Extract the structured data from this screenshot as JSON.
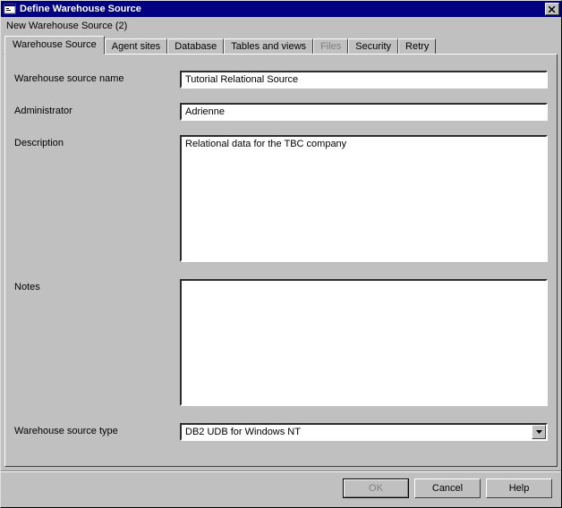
{
  "window": {
    "title": "Define Warehouse Source",
    "subtitle": "New Warehouse Source (2)"
  },
  "tabs": {
    "warehouse_source": "Warehouse Source",
    "agent_sites": "Agent sites",
    "database": "Database",
    "tables_and_views": "Tables and views",
    "files": "Files",
    "security": "Security",
    "retry": "Retry",
    "active": "warehouse_source",
    "disabled": [
      "files"
    ]
  },
  "labels": {
    "source_name": "Warehouse source name",
    "administrator": "Administrator",
    "description": "Description",
    "notes": "Notes",
    "source_type": "Warehouse source type"
  },
  "fields": {
    "source_name": "Tutorial Relational Source",
    "administrator": "Adrienne",
    "description": "Relational data for the TBC company",
    "notes": "",
    "source_type": "DB2 UDB for Windows NT"
  },
  "buttons": {
    "ok": "OK",
    "cancel": "Cancel",
    "help": "Help"
  },
  "colors": {
    "titlebar_bg": "#000080",
    "surface": "#c0c0c0"
  }
}
